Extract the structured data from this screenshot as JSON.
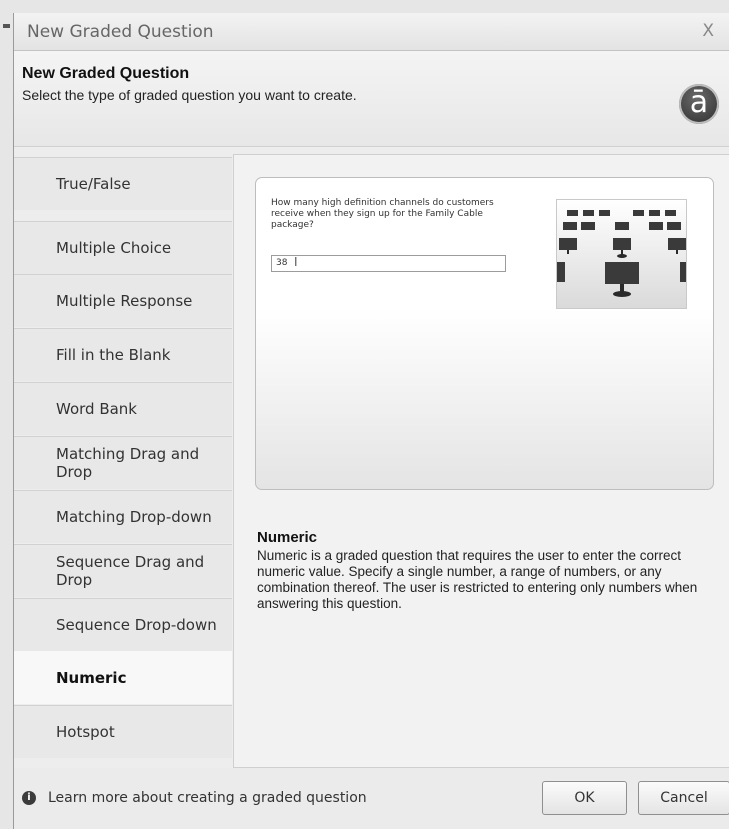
{
  "window": {
    "title": "New Graded Question",
    "close_glyph": "X"
  },
  "header": {
    "title": "New Graded Question",
    "subtitle": "Select the type of graded question you want to create.",
    "logo_glyph": "ā"
  },
  "sidebar": {
    "items": [
      {
        "label": "True/False"
      },
      {
        "label": "Multiple Choice"
      },
      {
        "label": "Multiple Response"
      },
      {
        "label": "Fill in the Blank"
      },
      {
        "label": "Word Bank"
      },
      {
        "label": "Matching Drag and Drop"
      },
      {
        "label": "Matching Drop-down"
      },
      {
        "label": "Sequence Drag and Drop"
      },
      {
        "label": "Sequence Drop-down"
      },
      {
        "label": "Numeric",
        "selected": true
      },
      {
        "label": "Hotspot"
      }
    ]
  },
  "preview": {
    "question": "How many high definition channels do customers receive when they sign up for the Family Cable package?",
    "answer_value": "38",
    "image_icon": "tv-screens-image"
  },
  "description": {
    "title": "Numeric",
    "body": "Numeric is a graded question that requires the user to enter the correct numeric value. Specify a single number, a range of numbers, or any combination thereof. The user is restricted to entering only numbers when answering this question."
  },
  "footer": {
    "info_glyph": "i",
    "learn_more": "Learn more about creating a graded question",
    "ok_label": "OK",
    "cancel_label": "Cancel"
  }
}
